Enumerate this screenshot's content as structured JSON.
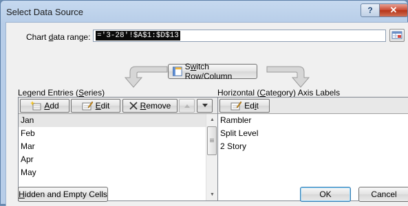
{
  "window": {
    "title": "Select Data Source",
    "help_label": "?",
    "close_label": "✕"
  },
  "chart_range": {
    "label_pre": "Chart ",
    "label_accel": "d",
    "label_post": "ata range:",
    "value": "='3-28'!$A$1:$D$13"
  },
  "switch_button": {
    "pre": "S",
    "accel": "w",
    "post": "itch Row/Column"
  },
  "legend": {
    "label_pre": "Legend Entries (",
    "label_accel": "S",
    "label_post": "eries)",
    "add_accel": "A",
    "add_post": "dd",
    "edit_accel": "E",
    "edit_post": "dit",
    "remove_accel": "R",
    "remove_post": "emove",
    "items": [
      "Jan",
      "Feb",
      "Mar",
      "Apr",
      "May"
    ]
  },
  "category": {
    "label_pre": "Horizontal (",
    "label_accel": "C",
    "label_post": "ategory) Axis Labels",
    "edit_pre": "Ed",
    "edit_accel": "i",
    "edit_post": "t",
    "items": [
      "Rambler",
      "Split Level",
      "2 Story"
    ]
  },
  "footer": {
    "hidden_accel": "H",
    "hidden_post": "idden and Empty Cells",
    "ok_label": "OK",
    "cancel_label": "Cancel"
  },
  "colors": {
    "selection": "#0a0a0a",
    "title_bar": "#c6d9ef",
    "close": "#c9472e"
  }
}
